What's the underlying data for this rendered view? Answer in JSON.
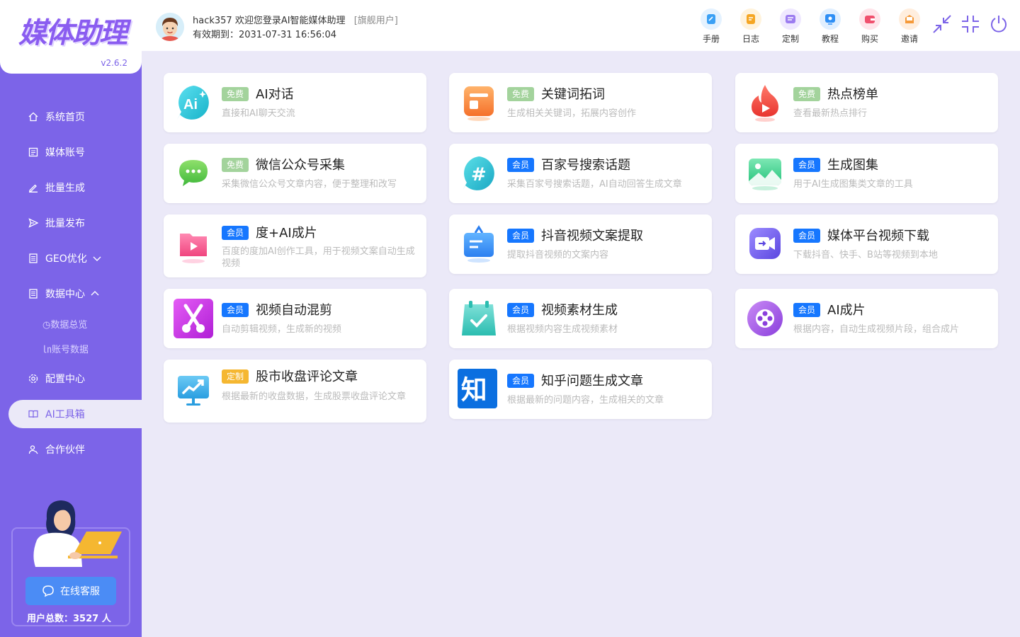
{
  "app": {
    "logo_text": "媒体助理",
    "version": "v2.6.2"
  },
  "user": {
    "greeting": "hack357 欢迎您登录AI智能媒体助理",
    "tier": "[旗舰用户]",
    "expiry": "有效期到：2031-07-31 16:56:04"
  },
  "toolbar": [
    {
      "label": "手册",
      "icon": "manual-icon",
      "color": "#3aa0f5"
    },
    {
      "label": "日志",
      "icon": "log-icon",
      "color": "#f5a623"
    },
    {
      "label": "定制",
      "icon": "custom-icon",
      "color": "#9c7cf0"
    },
    {
      "label": "教程",
      "icon": "tutorial-icon",
      "color": "#2f8ff5"
    },
    {
      "label": "购买",
      "icon": "buy-icon",
      "color": "#f0506e"
    },
    {
      "label": "邀请",
      "icon": "invite-icon",
      "color": "#f59a3a"
    }
  ],
  "sidebar": {
    "items": [
      {
        "label": "系统首页",
        "icon": "home-icon"
      },
      {
        "label": "媒体账号",
        "icon": "account-icon"
      },
      {
        "label": "批量生成",
        "icon": "edit-icon"
      },
      {
        "label": "批量发布",
        "icon": "send-icon"
      },
      {
        "label": "GEO优化",
        "icon": "doc-icon"
      },
      {
        "label": "数据中心",
        "icon": "doc-icon"
      },
      {
        "label": "配置中心",
        "icon": "gear-icon"
      },
      {
        "label": "AI工具箱",
        "icon": "book-icon"
      },
      {
        "label": "合作伙伴",
        "icon": "partner-icon"
      }
    ],
    "data_sub": [
      "◷数据总览",
      "㏑账号数据"
    ],
    "support_button": "在线客服",
    "user_count": "用户总数：3527 人"
  },
  "cards": [
    {
      "badge": "免费",
      "badge_type": "free",
      "title": "AI对话",
      "desc": "直接和AI聊天交流",
      "icon": "ai-chat-icon"
    },
    {
      "badge": "免费",
      "badge_type": "free",
      "title": "关键词拓词",
      "desc": "生成相关关键词，拓展内容创作",
      "icon": "keyword-icon"
    },
    {
      "badge": "免费",
      "badge_type": "free",
      "title": "热点榜单",
      "desc": "查看最新热点排行",
      "icon": "hot-list-icon"
    },
    {
      "badge": "免费",
      "badge_type": "free",
      "title": "微信公众号采集",
      "desc": "采集微信公众号文章内容，便于整理和改写",
      "icon": "wechat-icon"
    },
    {
      "badge": "会员",
      "badge_type": "member",
      "title": "百家号搜索话题",
      "desc": "采集百家号搜索话题，AI自动回答生成文章",
      "icon": "hashtag-icon"
    },
    {
      "badge": "会员",
      "badge_type": "member",
      "title": "生成图集",
      "desc": "用于AI生成图集类文章的工具",
      "icon": "image-icon"
    },
    {
      "badge": "会员",
      "badge_type": "member",
      "title": "度+AI成片",
      "desc": "百度的度加AI创作工具，用于视频文案自动生成视频",
      "icon": "video-folder-icon"
    },
    {
      "badge": "会员",
      "badge_type": "member",
      "title": "抖音视频文案提取",
      "desc": "提取抖音视频的文案内容",
      "icon": "extract-icon"
    },
    {
      "badge": "会员",
      "badge_type": "member",
      "title": "媒体平台视频下载",
      "desc": "下载抖音、快手、B站等视频到本地",
      "icon": "video-download-icon"
    },
    {
      "badge": "会员",
      "badge_type": "member",
      "title": "视频自动混剪",
      "desc": "自动剪辑视频，生成新的视频",
      "icon": "scissors-icon"
    },
    {
      "badge": "会员",
      "badge_type": "member",
      "title": "视频素材生成",
      "desc": "根据视频内容生成视频素材",
      "icon": "calendar-check-icon"
    },
    {
      "badge": "会员",
      "badge_type": "member",
      "title": "AI成片",
      "desc": "根据内容，自动生成视频片段，组合成片",
      "icon": "film-reel-icon"
    },
    {
      "badge": "定制",
      "badge_type": "custom",
      "title": "股市收盘评论文章",
      "desc": "根据最新的收盘数据，生成股票收盘评论文章",
      "icon": "stock-chart-icon"
    },
    {
      "badge": "会员",
      "badge_type": "member",
      "title": "知乎问题生成文章",
      "desc": "根据最新的问题内容，生成相关的文章",
      "icon": "zhihu-icon"
    }
  ]
}
